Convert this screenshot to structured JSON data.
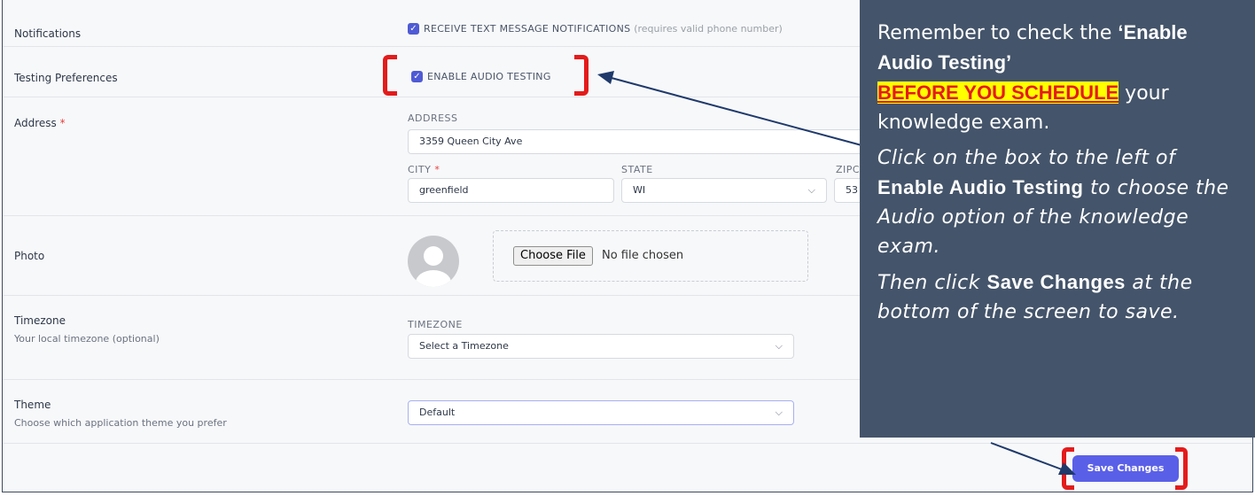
{
  "notifications": {
    "label": "Notifications",
    "checkbox_label": "RECEIVE TEXT MESSAGE NOTIFICATIONS",
    "checkbox_note": "(requires valid phone number)",
    "checked": true
  },
  "testing": {
    "label": "Testing Preferences",
    "checkbox_label": "ENABLE AUDIO TESTING",
    "checked": true
  },
  "address": {
    "label": "Address",
    "required_mark": "*",
    "address_caption": "ADDRESS",
    "address_value": "3359 Queen City Ave",
    "city_caption": "CITY",
    "city_value": "greenfield",
    "state_caption": "STATE",
    "state_value": "WI",
    "zip_caption": "ZIPC",
    "zip_value": "53"
  },
  "photo": {
    "label": "Photo",
    "choose_button": "Choose File",
    "file_status": "No file chosen"
  },
  "timezone": {
    "label": "Timezone",
    "sublabel": "Your local timezone (optional)",
    "caption": "TIMEZONE",
    "placeholder": "Select a Timezone"
  },
  "theme": {
    "label": "Theme",
    "sublabel": "Choose which application theme you prefer",
    "value": "Default"
  },
  "save_button": "Save Changes",
  "tooltip": {
    "p1_start": "Remember to check the ",
    "p1_bold": "‘Enable Audio Testing’",
    "p1_highlight": "BEFORE YOU SCHEDULE",
    "p1_end": " your knowledge exam.",
    "p2_start": "Click on the box to the left of ",
    "p2_bold": "Enable Audio Testing",
    "p2_end": " to choose the Audio option of the knowledge exam.",
    "p3_start": "Then click ",
    "p3_bold": "Save Changes",
    "p3_end": " at the bottom of the screen to save."
  },
  "colors": {
    "accent": "#5a5fe8",
    "annotation_red": "#e41b1b",
    "tooltip_bg": "#44546a",
    "highlight": "#ffff00"
  }
}
